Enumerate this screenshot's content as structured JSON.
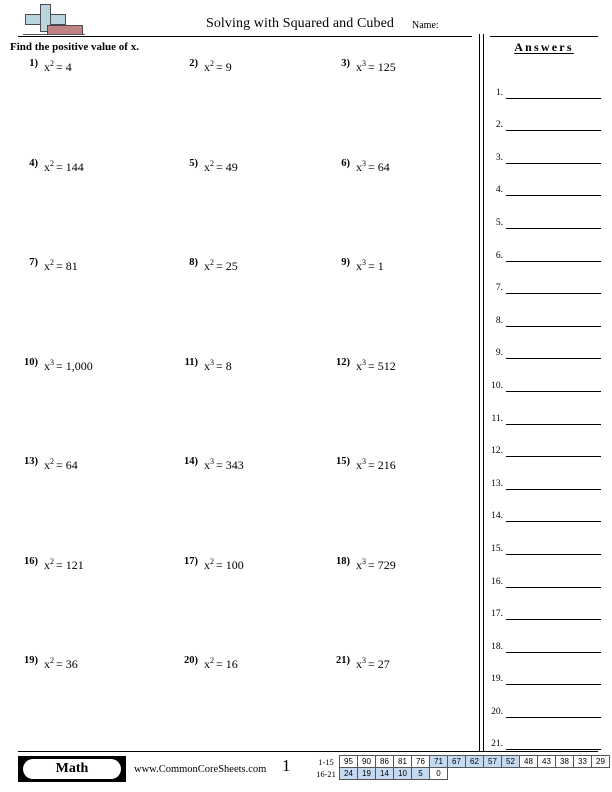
{
  "header": {
    "title": "Solving with Squared and Cubed",
    "name_label": "Name:",
    "instructions": "Find the positive value of x.",
    "logo_icon": "plus-minus-logo"
  },
  "answers": {
    "title": "Answers",
    "items": [
      "1.",
      "2.",
      "3.",
      "4.",
      "5.",
      "6.",
      "7.",
      "8.",
      "9.",
      "10.",
      "11.",
      "12.",
      "13.",
      "14.",
      "15.",
      "16.",
      "17.",
      "18.",
      "19.",
      "20.",
      "21."
    ]
  },
  "problems": [
    {
      "num": "1)",
      "base": "x",
      "exp": "2",
      "eq": "= 4"
    },
    {
      "num": "2)",
      "base": "x",
      "exp": "2",
      "eq": "= 9"
    },
    {
      "num": "3)",
      "base": "x",
      "exp": "3",
      "eq": "= 125"
    },
    {
      "num": "4)",
      "base": "x",
      "exp": "2",
      "eq": "= 144"
    },
    {
      "num": "5)",
      "base": "x",
      "exp": "2",
      "eq": "= 49"
    },
    {
      "num": "6)",
      "base": "x",
      "exp": "3",
      "eq": "= 64"
    },
    {
      "num": "7)",
      "base": "x",
      "exp": "2",
      "eq": "= 81"
    },
    {
      "num": "8)",
      "base": "x",
      "exp": "2",
      "eq": "= 25"
    },
    {
      "num": "9)",
      "base": "x",
      "exp": "3",
      "eq": "= 1"
    },
    {
      "num": "10)",
      "base": "x",
      "exp": "3",
      "eq": "= 1,000"
    },
    {
      "num": "11)",
      "base": "x",
      "exp": "3",
      "eq": "= 8"
    },
    {
      "num": "12)",
      "base": "x",
      "exp": "3",
      "eq": "= 512"
    },
    {
      "num": "13)",
      "base": "x",
      "exp": "2",
      "eq": "= 64"
    },
    {
      "num": "14)",
      "base": "x",
      "exp": "3",
      "eq": "= 343"
    },
    {
      "num": "15)",
      "base": "x",
      "exp": "3",
      "eq": "= 216"
    },
    {
      "num": "16)",
      "base": "x",
      "exp": "2",
      "eq": "= 121"
    },
    {
      "num": "17)",
      "base": "x",
      "exp": "2",
      "eq": "= 100"
    },
    {
      "num": "18)",
      "base": "x",
      "exp": "3",
      "eq": "= 729"
    },
    {
      "num": "19)",
      "base": "x",
      "exp": "2",
      "eq": "= 36"
    },
    {
      "num": "20)",
      "base": "x",
      "exp": "2",
      "eq": "= 16"
    },
    {
      "num": "21)",
      "base": "x",
      "exp": "3",
      "eq": "= 27"
    }
  ],
  "footer": {
    "subject": "Math",
    "url": "www.CommonCoreSheets.com",
    "page_number": "1"
  },
  "grading_scale": {
    "row1_label": "1-15",
    "row2_label": "16-21",
    "row1": [
      {
        "v": "95",
        "shaded": false
      },
      {
        "v": "90",
        "shaded": false
      },
      {
        "v": "86",
        "shaded": false
      },
      {
        "v": "81",
        "shaded": false
      },
      {
        "v": "76",
        "shaded": false
      },
      {
        "v": "71",
        "shaded": true
      },
      {
        "v": "67",
        "shaded": true
      },
      {
        "v": "62",
        "shaded": true
      },
      {
        "v": "57",
        "shaded": true
      },
      {
        "v": "52",
        "shaded": true
      },
      {
        "v": "48",
        "shaded": false
      },
      {
        "v": "43",
        "shaded": false
      },
      {
        "v": "38",
        "shaded": false
      },
      {
        "v": "33",
        "shaded": false
      },
      {
        "v": "29",
        "shaded": false
      }
    ],
    "row2": [
      {
        "v": "24",
        "shaded": true
      },
      {
        "v": "19",
        "shaded": true
      },
      {
        "v": "14",
        "shaded": true
      },
      {
        "v": "10",
        "shaded": true
      },
      {
        "v": "5",
        "shaded": true
      },
      {
        "v": "0",
        "shaded": false
      }
    ]
  },
  "colors": {
    "shade": "#c5d9f1",
    "logo_plus": "#b9d5de",
    "logo_minus": "#c08283",
    "rule": "#000000"
  }
}
